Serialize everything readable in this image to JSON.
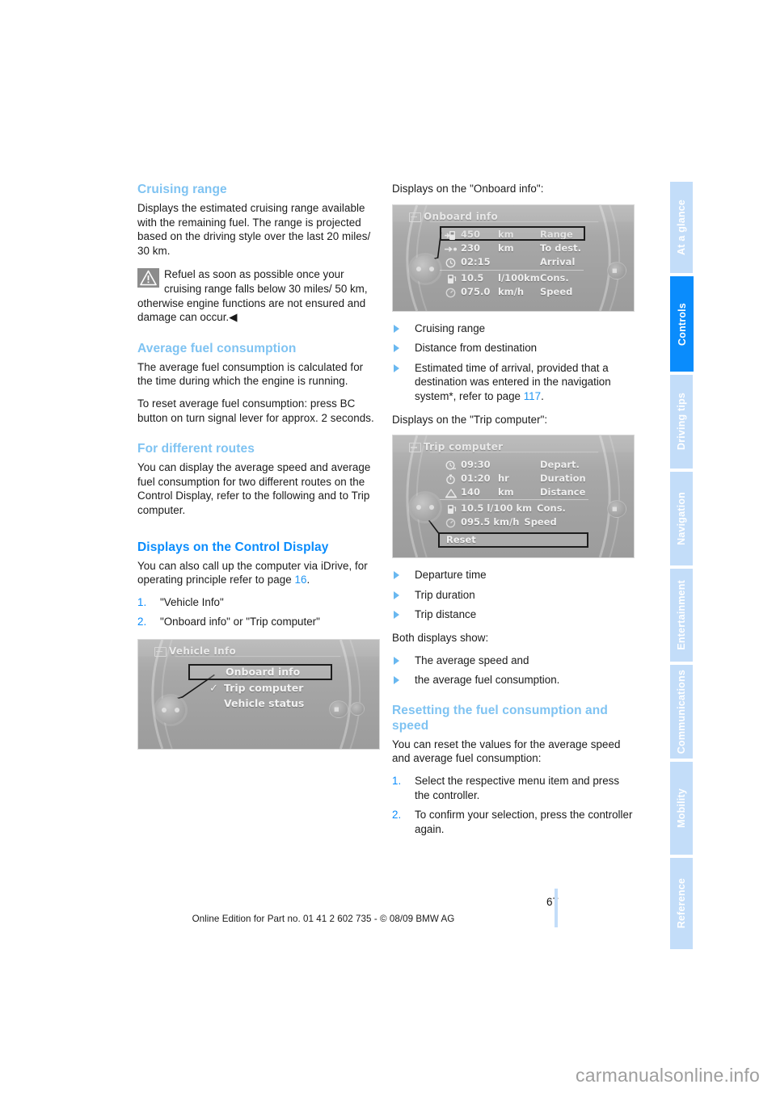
{
  "page": {
    "number": "67",
    "footer": "Online Edition for Part no. 01 41 2 602 735 - © 08/09 BMW AG",
    "watermark": "carmanualsonline.info"
  },
  "colors": {
    "heading_light": "#7fc3f2",
    "heading_dark": "#0a8cfc",
    "tab_inactive": "#c3ddf9",
    "tab_active": "#0a8cfc",
    "link": "#2196f3",
    "bullet": "#69b8f0"
  },
  "sidebar": {
    "tabs": [
      {
        "label": "At a glance",
        "active": false
      },
      {
        "label": "Controls",
        "active": true
      },
      {
        "label": "Driving tips",
        "active": false
      },
      {
        "label": "Navigation",
        "active": false
      },
      {
        "label": "Entertainment",
        "active": false
      },
      {
        "label": "Communications",
        "active": false
      },
      {
        "label": "Mobility",
        "active": false
      },
      {
        "label": "Reference",
        "active": false
      }
    ]
  },
  "left_column": {
    "cruising_range": {
      "heading": "Cruising range",
      "para1": "Displays the estimated cruising range available with the remaining fuel. The range is projected based on the driving style over the last 20 miles/ 30 km.",
      "warning": "Refuel as soon as possible once your cruising range falls below 30 miles/ 50 km, otherwise engine functions are not ensured and damage can occur.◀"
    },
    "average_fuel_consumption": {
      "heading": "Average fuel consumption",
      "para1": "The average fuel consumption is calculated for the time during which the engine is running.",
      "para2": "To reset average fuel consumption: press BC button on turn signal lever for approx. 2 seconds."
    },
    "for_different_routes": {
      "heading": "For different routes",
      "para1": "You can display the average speed and average fuel consumption for two different routes on the Control Display, refer to the following and to Trip computer."
    },
    "displays_control_display": {
      "heading": "Displays on the Control Display",
      "para1_a": "You can also call up the computer via iDrive, for operating principle refer to page ",
      "para1_link": "16",
      "para1_b": ".",
      "steps": [
        {
          "num": "1.",
          "text": "\"Vehicle Info\""
        },
        {
          "num": "2.",
          "text": "\"Onboard info\" or \"Trip computer\""
        }
      ]
    },
    "vehicle_info_shot": {
      "title": "Vehicle Info",
      "items": [
        {
          "label": "Onboard info",
          "selected": true,
          "checked": false
        },
        {
          "label": "Trip computer",
          "selected": false,
          "checked": true
        },
        {
          "label": "Vehicle status",
          "selected": false,
          "checked": false
        }
      ]
    }
  },
  "right_column": {
    "onboard_intro": "Displays on the \"Onboard info\":",
    "onboard_shot": {
      "title": "Onboard info",
      "rows": [
        {
          "icon": "fuel-range-icon",
          "value": "450",
          "unit": "km",
          "label": "Range",
          "selected": true
        },
        {
          "icon": "arrow-to-destination-icon",
          "value": "230",
          "unit": "km",
          "label": "To dest.",
          "selected": false
        },
        {
          "icon": "clock-arrival-icon",
          "value": "02:15",
          "unit": "",
          "label": "Arrival",
          "selected": false
        },
        {
          "icon": "fuel-pump-icon",
          "value": "10.5",
          "unit": "l/100km",
          "label": "Cons.",
          "selected": false
        },
        {
          "icon": "speedometer-icon",
          "value": "075.0",
          "unit": "km/h",
          "label": "Speed",
          "selected": false
        }
      ]
    },
    "onboard_bullets": [
      "Cruising range",
      "Distance from destination"
    ],
    "onboard_bullet3_a": "Estimated time of arrival, provided that a destination was entered in the navigation system*, refer to page ",
    "onboard_bullet3_link": "117",
    "onboard_bullet3_b": ".",
    "trip_intro": "Displays on the \"Trip computer\":",
    "trip_shot": {
      "title": "Trip computer",
      "rows": [
        {
          "icon": "departure-clock-icon",
          "value": "09:30",
          "unit": "",
          "label": "Depart.",
          "selected": false
        },
        {
          "icon": "stopwatch-icon",
          "value": "01:20",
          "unit": "hr",
          "label": "Duration",
          "selected": false
        },
        {
          "icon": "distance-road-icon",
          "value": "140",
          "unit": "km",
          "label": "Distance",
          "selected": false
        },
        {
          "icon": "fuel-pump-icon",
          "value": "10.5 l/100 km",
          "unit": "",
          "label": "Cons.",
          "selected": false
        },
        {
          "icon": "speedometer-icon",
          "value": "095.5 km/h",
          "unit": "",
          "label": "Speed",
          "selected": false
        }
      ],
      "reset_label": "Reset"
    },
    "trip_bullets": [
      "Departure time",
      "Trip duration",
      "Trip distance"
    ],
    "both_intro": "Both displays show:",
    "both_bullets": [
      "The average speed and",
      "the average fuel consumption."
    ],
    "resetting": {
      "heading": "Resetting the fuel consumption and speed",
      "para1": "You can reset the values for the average speed and average fuel consumption:",
      "steps": [
        {
          "num": "1.",
          "text": "Select the respective menu item and press the controller."
        },
        {
          "num": "2.",
          "text": "To confirm your selection, press the controller again."
        }
      ]
    }
  }
}
